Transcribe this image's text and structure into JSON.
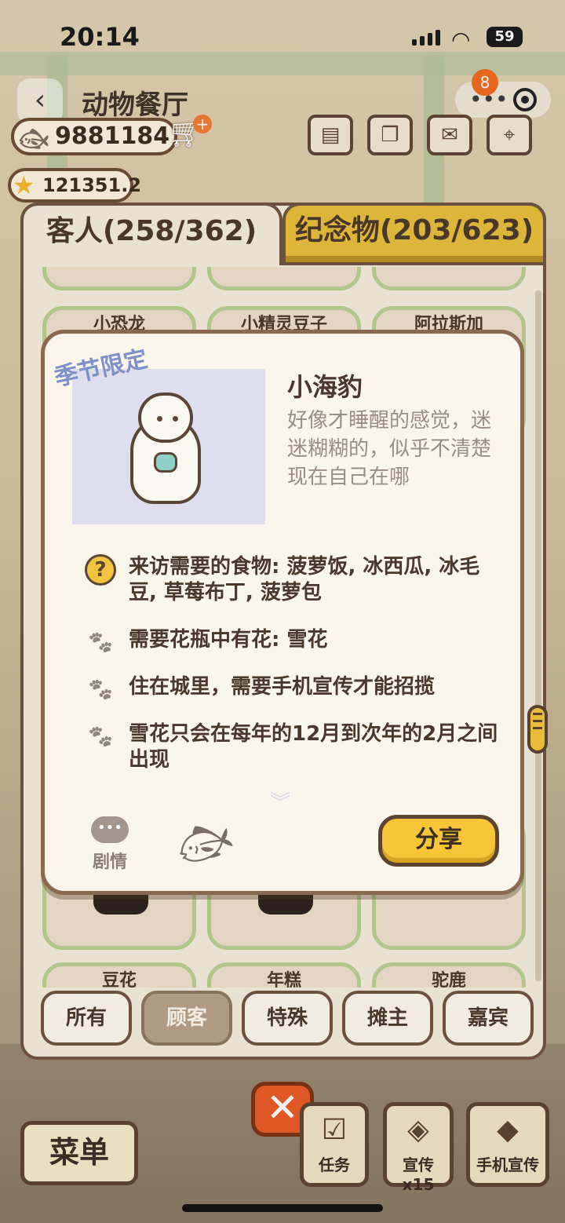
{
  "status_bar": {
    "time": "20:14",
    "battery": "59"
  },
  "header": {
    "title": "动物餐厅",
    "notification_count": "8"
  },
  "currency": {
    "fish": "9881184",
    "stars": "121351.2"
  },
  "tabs": [
    {
      "label": "客人(258/362)",
      "active": true
    },
    {
      "label": "纪念物(203/623)",
      "active": false
    }
  ],
  "grid": {
    "top_row": [
      "小恐龙",
      "小精灵豆子",
      "阿拉斯加"
    ],
    "bottom_row": [
      "豆花",
      "年糕",
      "驼鹿"
    ]
  },
  "filters": [
    {
      "label": "所有",
      "active": false
    },
    {
      "label": "顾客",
      "active": true
    },
    {
      "label": "特殊",
      "active": false
    },
    {
      "label": "摊主",
      "active": false
    },
    {
      "label": "嘉宾",
      "active": false
    }
  ],
  "modal": {
    "tag": "季节限定",
    "name": "小海豹",
    "description": "好像才睡醒的感觉，迷迷糊糊的，似乎不清楚现在自己在哪",
    "requirements": [
      {
        "icon": "question-icon",
        "text": "来访需要的食物: 菠萝饭, 冰西瓜, 冰毛豆, 草莓布丁, 菠萝包"
      },
      {
        "icon": "paw-icon",
        "text": "需要花瓶中有花: 雪花"
      },
      {
        "icon": "paw-icon",
        "text": "住在城里，需要手机宣传才能招揽"
      },
      {
        "icon": "paw-icon",
        "text": "雪花只会在每年的12月到次年的2月之间出现"
      }
    ],
    "story_label": "剧情",
    "share_label": "分享"
  },
  "hud": {
    "menu_label": "菜单",
    "task_label": "任务",
    "promo_label": "宣传x15",
    "phone_promo_label": "手机宣传"
  },
  "colors": {
    "accent_yellow": "#f6c538",
    "border_brown": "#6d5442",
    "close_orange": "#e75a25"
  }
}
